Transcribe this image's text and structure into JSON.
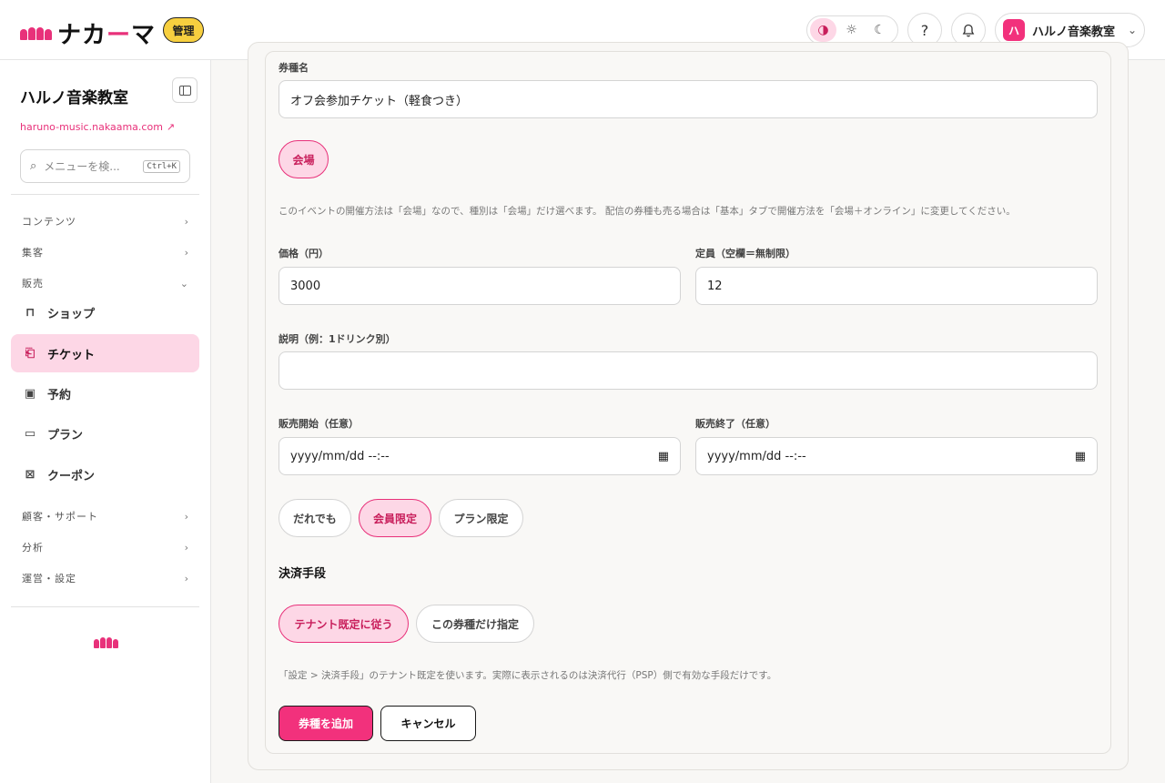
{
  "header": {
    "logo_main": "ナカ",
    "logo_accent": "ー",
    "logo_tail": "マ",
    "admin_badge": "管理",
    "theme_icons": [
      "contrast-icon",
      "sun-icon",
      "moon-icon"
    ],
    "tenant_logo": "ハ",
    "tenant_name": "ハルノ音楽教室"
  },
  "sidebar": {
    "title": "ハルノ音楽教室",
    "url": "haruno-music.nakaama.com",
    "search_placeholder": "メニューを検...",
    "search_shortcut": "Ctrl+K",
    "groups": {
      "contents": "コンテンツ",
      "attract": "集客",
      "sales": "販売",
      "customer": "顧客・サポート",
      "analytics": "分析",
      "settings": "運営・設定"
    },
    "items": {
      "shop": "ショップ",
      "ticket": "チケット",
      "reserve": "予約",
      "plan": "プラン",
      "coupon": "クーポン"
    }
  },
  "form": {
    "ticket_name_label": "券種名",
    "ticket_name_value": "オフ会参加チケット（軽食つき）",
    "venue_type": "会場",
    "venue_hint": "このイベントの開催方法は「会場」なので、種別は「会場」だけ選べます。 配信の券種も売る場合は「基本」タブで開催方法を「会場＋オンライン」に変更してください。",
    "price_label": "価格（円）",
    "price_value": "3000",
    "capacity_label": "定員（空欄＝無制限）",
    "capacity_value": "12",
    "desc_label": "説明（例：1ドリンク別）",
    "desc_value": "",
    "sale_start_label": "販売開始（任意）",
    "sale_start_value": "yyyy/mm/dd --:--",
    "sale_end_label": "販売終了（任意）",
    "sale_end_value": "yyyy/mm/dd --:--",
    "audience": {
      "anyone": "だれでも",
      "members": "会員限定",
      "plan": "プラン限定"
    },
    "payment_title": "決済手段",
    "payment": {
      "tenant_default": "テナント既定に従う",
      "custom": "この券種だけ指定"
    },
    "payment_hint": "「設定 > 決済手段」のテナント既定を使います。実際に表示されるのは決済代行（PSP）側で有効な手段だけです。",
    "submit": "券種を追加",
    "cancel": "キャンセル"
  },
  "colors": {
    "accent": "#f2317c",
    "accent_soft": "#fdd7e6",
    "badge": "#f7cf3f"
  }
}
